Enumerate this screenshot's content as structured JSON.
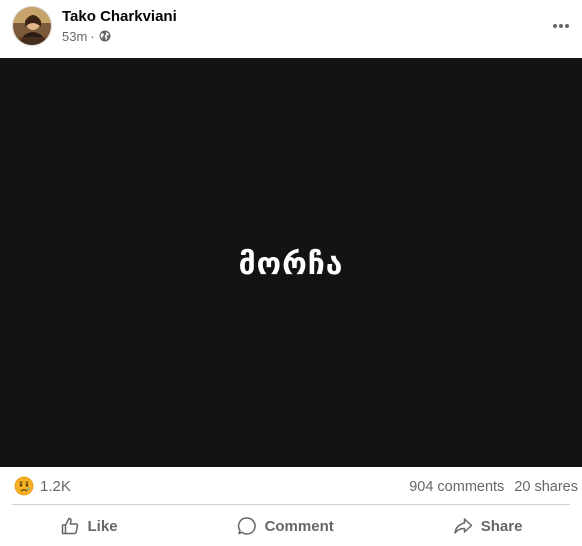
{
  "post": {
    "author": "Tako Charkviani",
    "time": "53m",
    "separator": "·",
    "privacy_icon": "globe-icon",
    "more_icon": "ellipsis-icon",
    "media_text": "მორჩა"
  },
  "stats": {
    "reaction_icon": "sad-reaction-icon",
    "reaction_count": "1.2K",
    "comments": "904 comments",
    "shares": "20 shares"
  },
  "actions": {
    "like": "Like",
    "comment": "Comment",
    "share": "Share"
  },
  "colors": {
    "media_background": "#131313",
    "secondary_text": "#65676b",
    "primary_text": "#050505"
  }
}
